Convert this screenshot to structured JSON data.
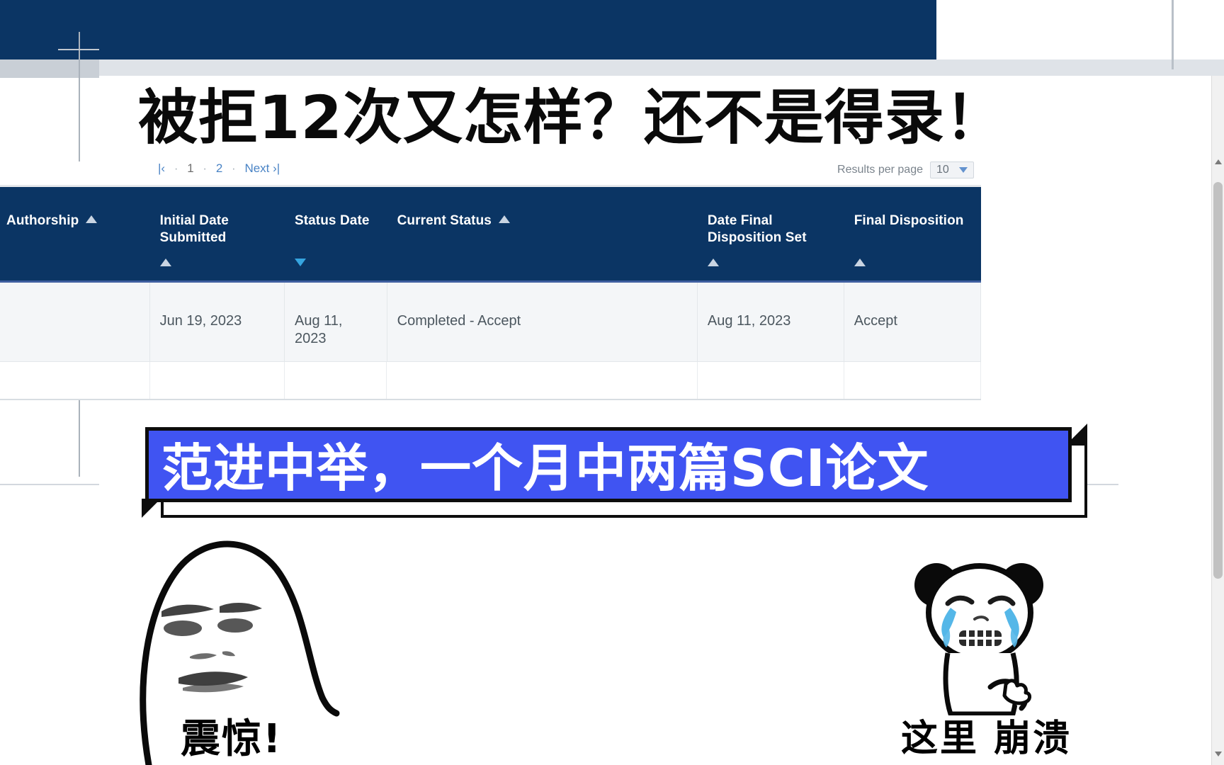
{
  "headline": "被拒12次又怎样？还不是得录！",
  "table": {
    "pagination": {
      "prev_label": "|‹",
      "pages": [
        "1",
        "2"
      ],
      "current_page": "1",
      "next_label": "Next ›|"
    },
    "results_per_page": {
      "label": "Results per page",
      "value": "10",
      "caret_icon": "chevron-down-icon"
    },
    "columns": [
      {
        "label": "Authorship",
        "sort": "asc",
        "sort_icon": "sort-ascending-icon"
      },
      {
        "label": "Initial Date Submitted",
        "sort": "asc",
        "sort_icon": "sort-ascending-icon"
      },
      {
        "label": "Status Date",
        "sort": "desc",
        "sort_icon": "sort-descending-icon"
      },
      {
        "label": "Current Status",
        "sort": "asc",
        "sort_icon": "sort-ascending-icon"
      },
      {
        "label": "Date Final Disposition Set",
        "sort": "asc",
        "sort_icon": "sort-ascending-icon"
      },
      {
        "label": "Final Disposition",
        "sort": "asc",
        "sort_icon": "sort-ascending-icon"
      }
    ],
    "rows": [
      {
        "authorship": "",
        "initial_date_submitted": "Jun 19, 2023",
        "status_date": "Aug 11, 2023",
        "current_status": "Completed - Accept",
        "date_final_disposition_set": "Aug 11, 2023",
        "final_disposition": "Accept"
      }
    ]
  },
  "banner": {
    "text": "范进中举，一个月中两篇SCI论文",
    "fill_color": "#4054F2",
    "text_color": "#FFFFFF",
    "outline_color": "#0D0D0D"
  },
  "annotations": {
    "shock_label": "震惊!",
    "panda_label": "这里 崩溃",
    "face_icon": "shocked-face-meme-icon",
    "panda_icon": "crying-panda-meme-icon"
  },
  "colors": {
    "header_navy": "#0B3564",
    "row_gray": "#F4F6F8",
    "link_blue": "#2A6EBB",
    "sort_active_blue": "#36A5E0"
  }
}
